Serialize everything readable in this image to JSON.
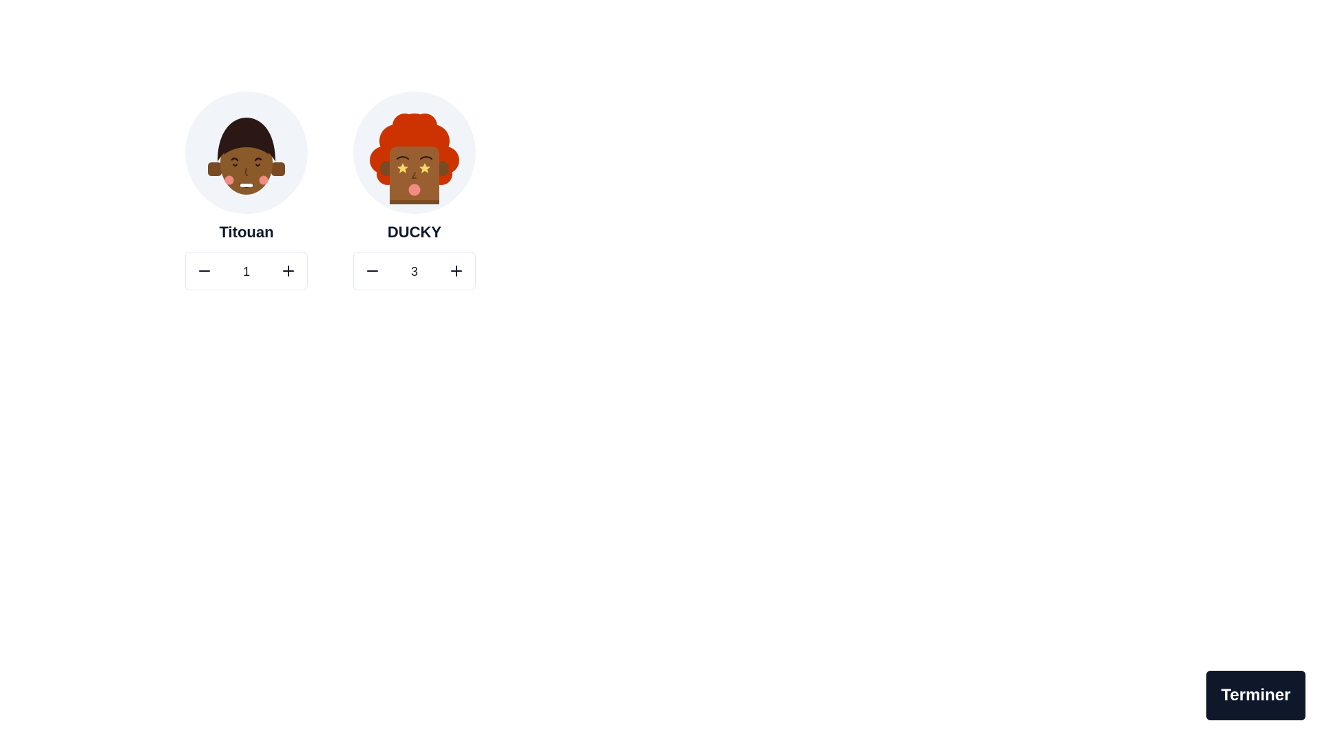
{
  "players": [
    {
      "name": "Titouan",
      "count": "1",
      "avatar_icon": "avatar-dark-hair-smiling-icon",
      "decrement_icon": "minus-icon",
      "increment_icon": "plus-icon"
    },
    {
      "name": "DUCKY",
      "count": "3",
      "avatar_icon": "avatar-red-curly-hair-star-eyes-icon",
      "decrement_icon": "minus-icon",
      "increment_icon": "plus-icon"
    }
  ],
  "actions": {
    "finish_label": "Terminer"
  },
  "colors": {
    "primary": "#0f172a",
    "avatar_bg": "#f1f5f9",
    "border": "#e2e8f0",
    "skin": "#8b5a2b",
    "dark_hair": "#2b1714",
    "red_hair": "#cc3300",
    "cheek": "#f28b82",
    "star": "#f7d96b"
  }
}
